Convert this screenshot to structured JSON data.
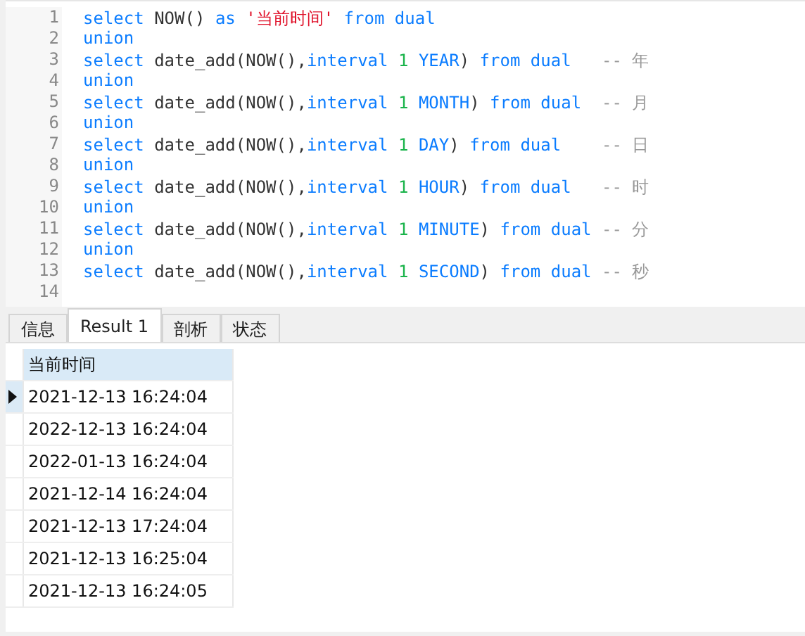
{
  "editor": {
    "lines": [
      {
        "number": "1",
        "tokens": [
          {
            "kind": "keyword",
            "text": "select "
          },
          {
            "kind": "plain",
            "text": "NOW() "
          },
          {
            "kind": "keyword",
            "text": "as "
          },
          {
            "kind": "string",
            "text": "'当前时间'"
          },
          {
            "kind": "keyword",
            "text": " from dual"
          }
        ]
      },
      {
        "number": "2",
        "tokens": [
          {
            "kind": "keyword",
            "text": "union"
          }
        ]
      },
      {
        "number": "3",
        "tokens": [
          {
            "kind": "keyword",
            "text": "select "
          },
          {
            "kind": "plain",
            "text": "date_add(NOW(),"
          },
          {
            "kind": "keyword",
            "text": "interval "
          },
          {
            "kind": "number",
            "text": "1"
          },
          {
            "kind": "keyword",
            "text": " YEAR"
          },
          {
            "kind": "plain",
            "text": ")"
          },
          {
            "kind": "keyword",
            "text": " from dual   "
          },
          {
            "kind": "comment",
            "text": "-- 年"
          }
        ]
      },
      {
        "number": "4",
        "tokens": [
          {
            "kind": "keyword",
            "text": "union"
          }
        ]
      },
      {
        "number": "5",
        "tokens": [
          {
            "kind": "keyword",
            "text": "select "
          },
          {
            "kind": "plain",
            "text": "date_add(NOW(),"
          },
          {
            "kind": "keyword",
            "text": "interval "
          },
          {
            "kind": "number",
            "text": "1"
          },
          {
            "kind": "keyword",
            "text": " MONTH"
          },
          {
            "kind": "plain",
            "text": ")"
          },
          {
            "kind": "keyword",
            "text": " from dual  "
          },
          {
            "kind": "comment",
            "text": "-- 月"
          }
        ]
      },
      {
        "number": "6",
        "tokens": [
          {
            "kind": "keyword",
            "text": "union"
          }
        ]
      },
      {
        "number": "7",
        "tokens": [
          {
            "kind": "keyword",
            "text": "select "
          },
          {
            "kind": "plain",
            "text": "date_add(NOW(),"
          },
          {
            "kind": "keyword",
            "text": "interval "
          },
          {
            "kind": "number",
            "text": "1"
          },
          {
            "kind": "keyword",
            "text": " DAY"
          },
          {
            "kind": "plain",
            "text": ")"
          },
          {
            "kind": "keyword",
            "text": " from dual    "
          },
          {
            "kind": "comment",
            "text": "-- 日"
          }
        ]
      },
      {
        "number": "8",
        "tokens": [
          {
            "kind": "keyword",
            "text": "union"
          }
        ]
      },
      {
        "number": "9",
        "tokens": [
          {
            "kind": "keyword",
            "text": "select "
          },
          {
            "kind": "plain",
            "text": "date_add(NOW(),"
          },
          {
            "kind": "keyword",
            "text": "interval "
          },
          {
            "kind": "number",
            "text": "1"
          },
          {
            "kind": "keyword",
            "text": " HOUR"
          },
          {
            "kind": "plain",
            "text": ")"
          },
          {
            "kind": "keyword",
            "text": " from dual   "
          },
          {
            "kind": "comment",
            "text": "-- 时"
          }
        ]
      },
      {
        "number": "10",
        "tokens": [
          {
            "kind": "keyword",
            "text": "union"
          }
        ]
      },
      {
        "number": "11",
        "tokens": [
          {
            "kind": "keyword",
            "text": "select "
          },
          {
            "kind": "plain",
            "text": "date_add(NOW(),"
          },
          {
            "kind": "keyword",
            "text": "interval "
          },
          {
            "kind": "number",
            "text": "1"
          },
          {
            "kind": "keyword",
            "text": " MINUTE"
          },
          {
            "kind": "plain",
            "text": ")"
          },
          {
            "kind": "keyword",
            "text": " from dual "
          },
          {
            "kind": "comment",
            "text": "-- 分"
          }
        ]
      },
      {
        "number": "12",
        "tokens": [
          {
            "kind": "keyword",
            "text": "union"
          }
        ]
      },
      {
        "number": "13",
        "tokens": [
          {
            "kind": "keyword",
            "text": "select "
          },
          {
            "kind": "plain",
            "text": "date_add(NOW(),"
          },
          {
            "kind": "keyword",
            "text": "interval "
          },
          {
            "kind": "number",
            "text": "1"
          },
          {
            "kind": "keyword",
            "text": " SECOND"
          },
          {
            "kind": "plain",
            "text": ")"
          },
          {
            "kind": "keyword",
            "text": " from dual "
          },
          {
            "kind": "comment",
            "text": "-- 秒"
          }
        ]
      },
      {
        "number": "14"
      }
    ]
  },
  "tabs": [
    {
      "label": "信息",
      "selected": false
    },
    {
      "label": "Result 1",
      "selected": true
    },
    {
      "label": "剖析",
      "selected": false
    },
    {
      "label": "状态",
      "selected": false
    }
  ],
  "table": {
    "columns": [
      "当前时间"
    ],
    "rows": [
      {
        "cells": [
          "2021-12-13 16:24:04"
        ],
        "selected": true
      },
      {
        "cells": [
          "2022-12-13 16:24:04"
        ],
        "selected": false
      },
      {
        "cells": [
          "2022-01-13 16:24:04"
        ],
        "selected": false
      },
      {
        "cells": [
          "2021-12-14 16:24:04"
        ],
        "selected": false
      },
      {
        "cells": [
          "2021-12-13 17:24:04"
        ],
        "selected": false
      },
      {
        "cells": [
          "2021-12-13 16:25:04"
        ],
        "selected": false
      },
      {
        "cells": [
          "2021-12-13 16:24:05"
        ],
        "selected": false
      }
    ]
  }
}
